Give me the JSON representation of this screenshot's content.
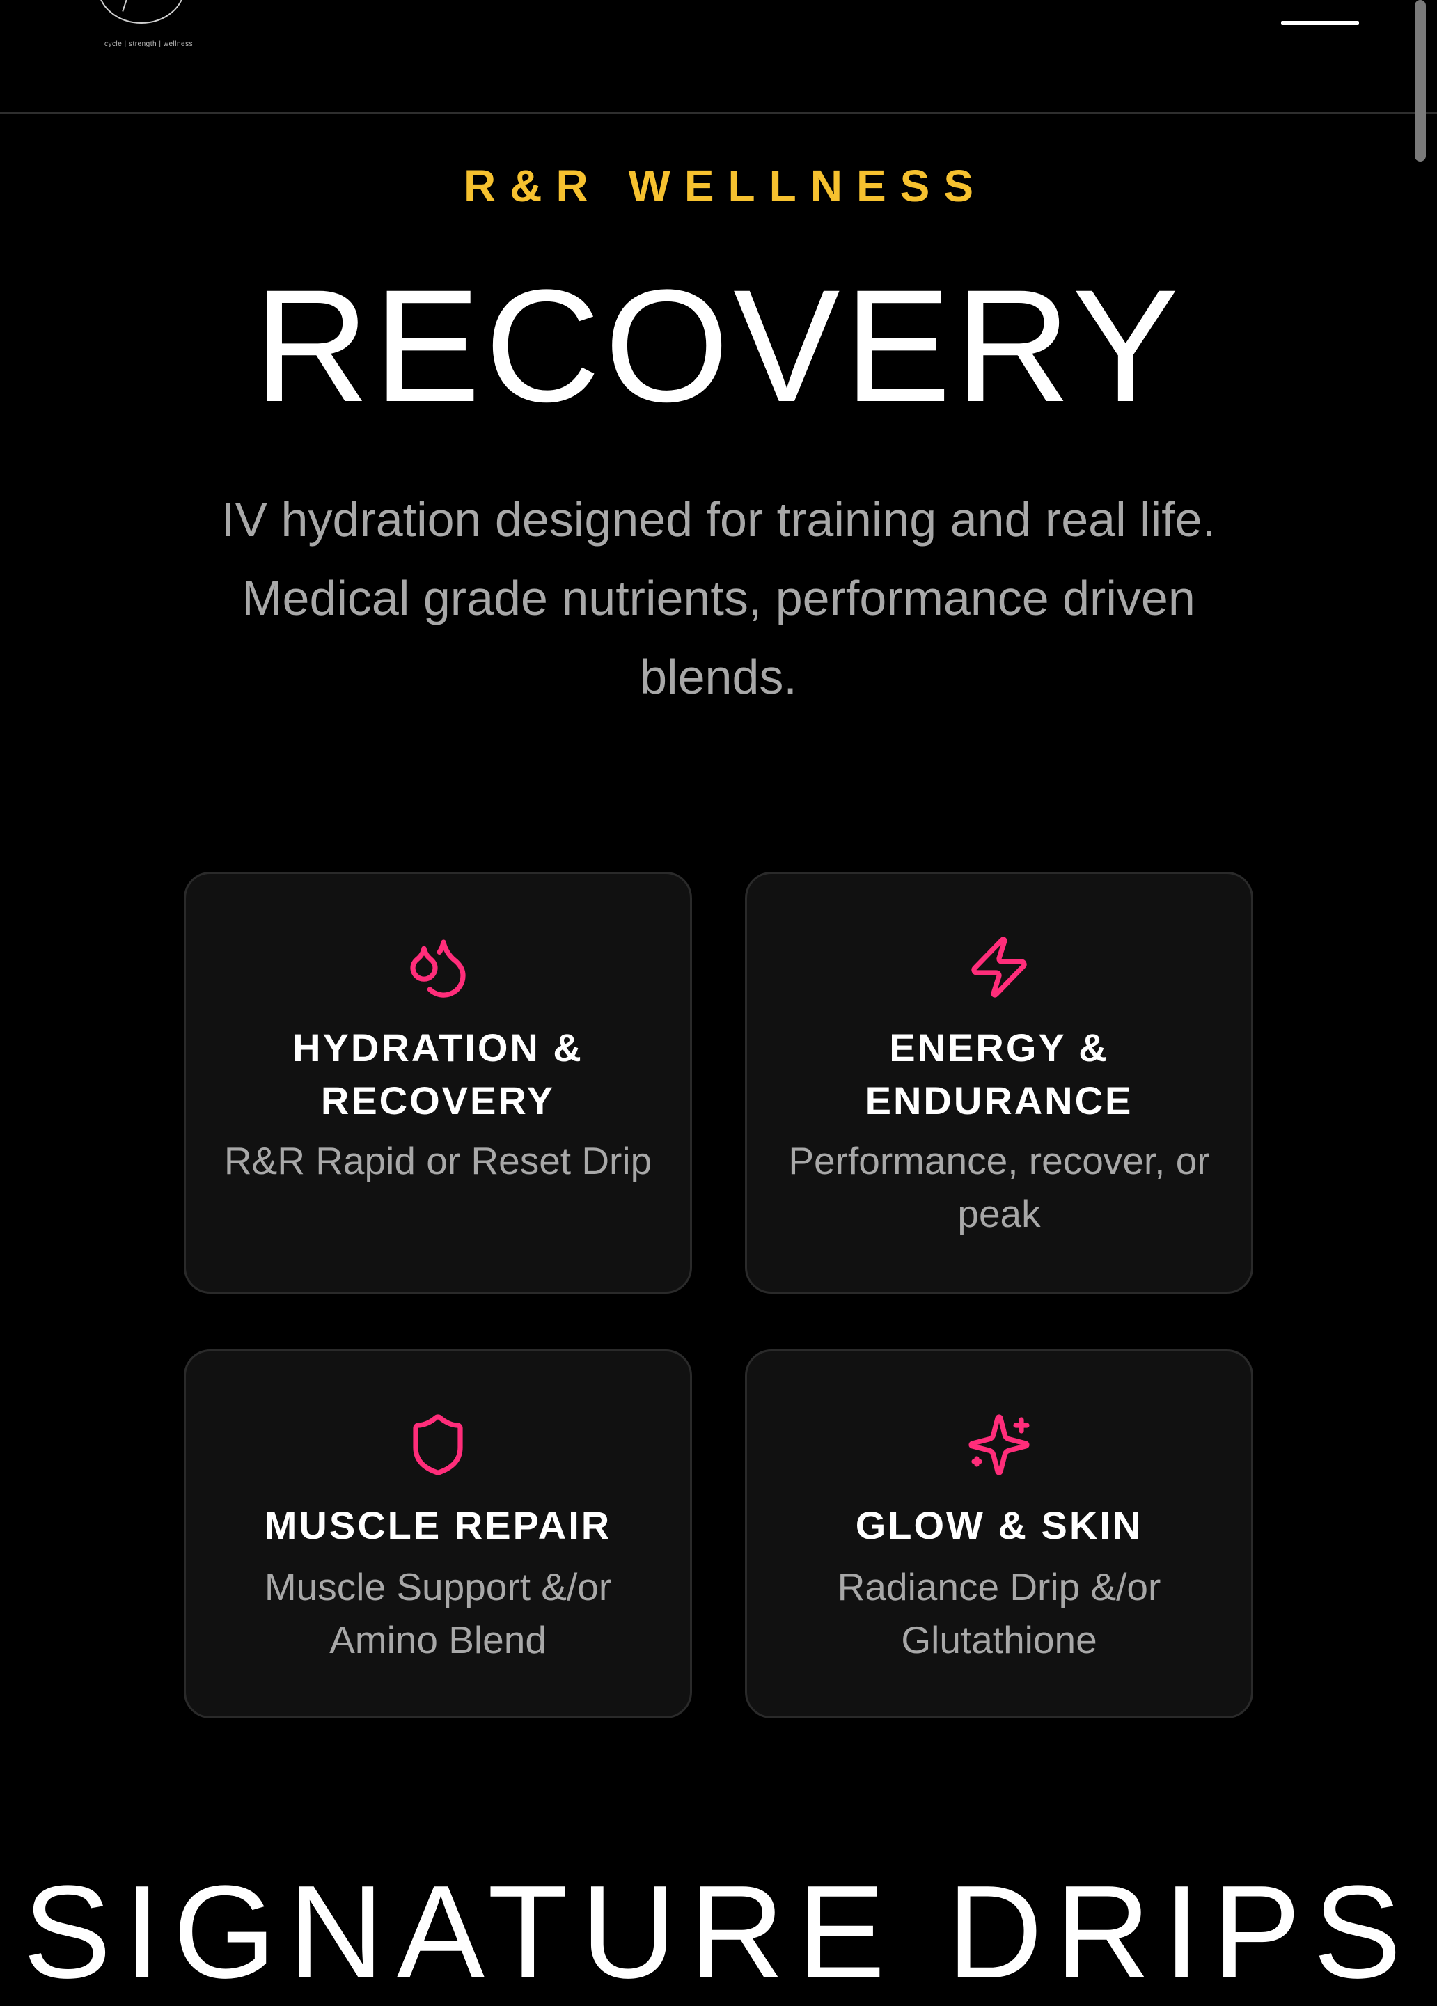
{
  "header": {
    "logo_tagline": "cycle | strength | wellness",
    "menu_icon": "hamburger-menu-icon"
  },
  "hero": {
    "eyebrow": "R&R WELLNESS",
    "title": "RECOVERY",
    "intro": "IV hydration designed for training and real life. Medical grade nutrients, performance driven blends."
  },
  "colors": {
    "accent_yellow": "#f6c12f",
    "accent_pink": "#ff2d7a",
    "card_bg": "#111111",
    "card_border": "#2a2a2a",
    "muted_text": "#a8a8a8"
  },
  "cards": [
    {
      "icon": "droplets-icon",
      "title": "HYDRATION & RECOVERY",
      "subtitle": "R&R Rapid or Reset Drip"
    },
    {
      "icon": "lightning-bolt-icon",
      "title": "ENERGY & ENDURANCE",
      "subtitle": "Performance, recover, or peak"
    },
    {
      "icon": "shield-icon",
      "title": "MUSCLE REPAIR",
      "subtitle": "Muscle Support &/or Amino Blend"
    },
    {
      "icon": "sparkles-icon",
      "title": "GLOW & SKIN",
      "subtitle": "Radiance Drip &/or Glutathione"
    }
  ],
  "next_section": {
    "title": "SIGNATURE DRIPS"
  }
}
